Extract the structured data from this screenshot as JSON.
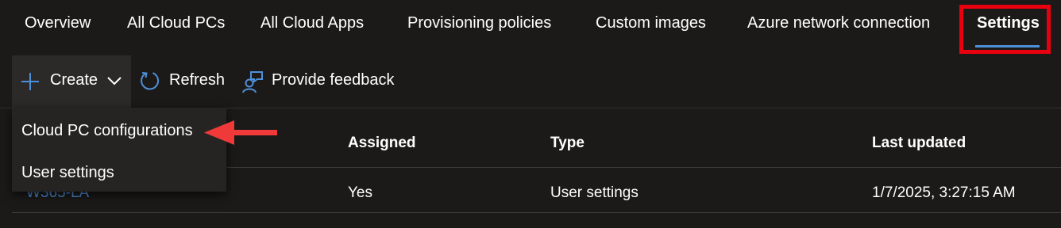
{
  "tabs": [
    {
      "label": "Overview"
    },
    {
      "label": "All Cloud PCs"
    },
    {
      "label": "All Cloud Apps"
    },
    {
      "label": "Provisioning policies"
    },
    {
      "label": "Custom images"
    },
    {
      "label": "Azure network connection"
    },
    {
      "label": "Settings",
      "active": true
    }
  ],
  "toolbar": {
    "create_label": "Create",
    "refresh_label": "Refresh",
    "feedback_label": "Provide feedback"
  },
  "create_menu": {
    "items": [
      {
        "label": "Cloud PC configurations"
      },
      {
        "label": "User settings"
      }
    ]
  },
  "table": {
    "columns": [
      "Assigned",
      "Type",
      "Last updated"
    ],
    "rows": [
      {
        "name": "W365-LA",
        "assigned": "Yes",
        "type": "User settings",
        "last_updated": "1/7/2025, 3:27:15 AM"
      }
    ]
  },
  "colors": {
    "background": "#1b1a19",
    "accent": "#4f8fd8",
    "highlight": "#e8000f",
    "annotation_arrow": "#f03a3a"
  }
}
